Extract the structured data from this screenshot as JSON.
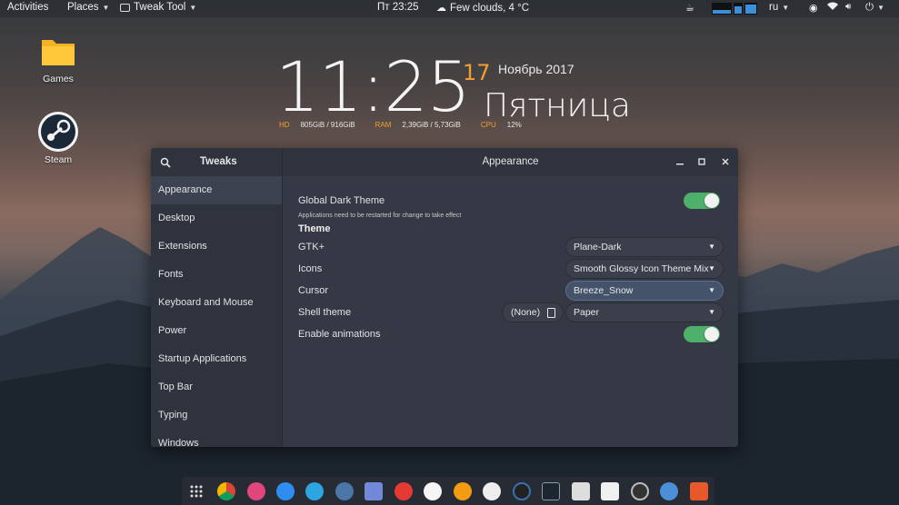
{
  "topbar": {
    "activities": "Activities",
    "places": "Places",
    "app_menu": "Tweak Tool",
    "clock": "Пт 23:25",
    "weather": "Few clouds, 4 °C",
    "language": "ru"
  },
  "desktop": {
    "icons": [
      {
        "label": "Games"
      },
      {
        "label": "Steam"
      }
    ]
  },
  "widget": {
    "time": "11:25",
    "day": "17",
    "month_year": "Ноябрь 2017",
    "weekday": "Пятница",
    "hd_label": "HD",
    "hd_value": "805GiB / 916GiB",
    "ram_label": "RAM",
    "ram_value": "2,39GiB / 5,73GiB",
    "cpu_label": "CPU",
    "cpu_value": "12%"
  },
  "window": {
    "sidebar_title": "Tweaks",
    "title": "Appearance",
    "sidebar": [
      {
        "label": "Appearance",
        "active": true
      },
      {
        "label": "Desktop"
      },
      {
        "label": "Extensions"
      },
      {
        "label": "Fonts"
      },
      {
        "label": "Keyboard and Mouse"
      },
      {
        "label": "Power"
      },
      {
        "label": "Startup Applications"
      },
      {
        "label": "Top Bar"
      },
      {
        "label": "Typing"
      },
      {
        "label": "Windows"
      }
    ],
    "global_dark_label": "Global Dark Theme",
    "global_dark_note": "Applications need to be restarted for change to take effect",
    "theme_section": "Theme",
    "gtk_label": "GTK+",
    "gtk_value": "Plane-Dark",
    "icons_label": "Icons",
    "icons_value": "Smooth Glossy Icon Theme Mix",
    "cursor_label": "Cursor",
    "cursor_value": "Breeze_Snow",
    "shell_label": "Shell theme",
    "shell_none": "(None)",
    "shell_value": "Paper",
    "animations_label": "Enable animations",
    "global_dark_on": true,
    "animations_on": true
  },
  "colors": {
    "accent_orange": "#f0a030",
    "toggle_on": "#4fb06b",
    "window_bg": "#353945",
    "sidebar_bg": "#2f333d"
  }
}
